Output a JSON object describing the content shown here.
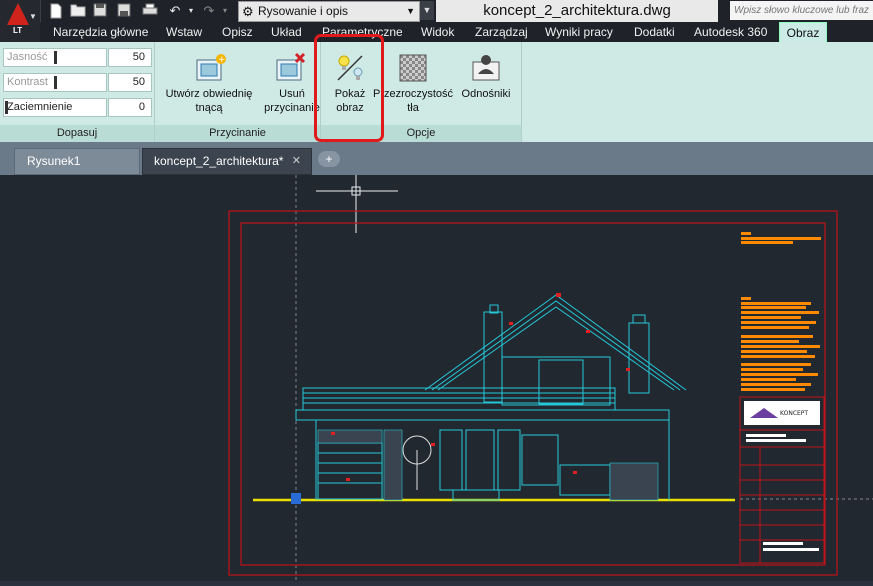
{
  "app": {
    "edition_badge": "LT"
  },
  "workspace": {
    "label": "Rysowanie i opis"
  },
  "document_title": "koncept_2_architektura.dwg",
  "search": {
    "placeholder": "Wpisz słowo kluczowe lub fraz"
  },
  "ribbon_tabs": [
    "Narzędzia główne",
    "Wstaw",
    "Opisz",
    "Układ",
    "Parametryczne",
    "Widok",
    "Zarządzaj",
    "Wyniki pracy",
    "Dodatki",
    "Autodesk 360",
    "Obraz"
  ],
  "active_ribbon_tab": "Obraz",
  "panels": {
    "dopasuj": {
      "title": "Dopasuj",
      "sliders": [
        {
          "label": "Jasność",
          "value": "50"
        },
        {
          "label": "Kontrast",
          "value": "50"
        },
        {
          "label": "Zaciemnienie",
          "value": "0"
        }
      ]
    },
    "przycinanie": {
      "title": "Przycinanie",
      "create_clip": {
        "line1": "Utwórz obwiednię",
        "line2": "tnącą"
      },
      "remove_clip": {
        "line1": "Usuń",
        "line2": "przycinanie"
      }
    },
    "opcje": {
      "title": "Opcje",
      "show_image": {
        "line1": "Pokaż",
        "line2": "obraz"
      },
      "transparency": {
        "line1": "Przezroczystość",
        "line2": "tła"
      },
      "references": {
        "line1": "Odnośniki"
      }
    }
  },
  "doc_tabs": [
    {
      "label": "Rysunek1",
      "active": false
    },
    {
      "label": "koncept_2_architektura*",
      "active": true
    }
  ],
  "titleblock": {
    "logo_text": "KONCEPT"
  },
  "colors": {
    "ribbon_bg": "#cfeae5",
    "canvas_bg": "#212830",
    "frame_red": "#c0131a",
    "drawing_cyan": "#27c7d8",
    "annotation_orange": "#ff8a00",
    "ground_yellow": "#e8e000",
    "highlight_red": "#e0191b"
  },
  "icons": [
    "autocad-logo-icon",
    "new-icon",
    "open-icon",
    "save-icon",
    "save-as-icon",
    "print-icon",
    "undo-icon",
    "redo-icon",
    "gear-icon",
    "create-clip-icon",
    "remove-clip-icon",
    "show-image-icon",
    "transparency-icon",
    "external-references-icon",
    "close-tab-icon",
    "new-tab-icon"
  ]
}
